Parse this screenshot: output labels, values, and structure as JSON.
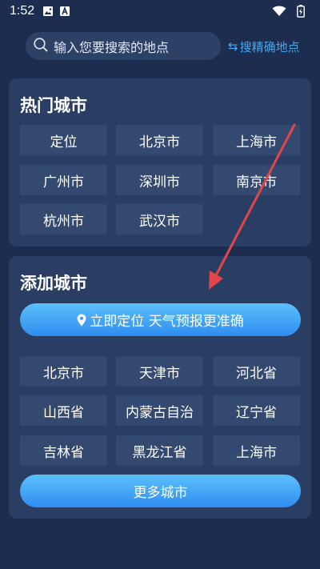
{
  "status_bar": {
    "time": "1:52",
    "icons": [
      "image-icon",
      "a-box-icon",
      "wifi-icon",
      "battery-charging-icon"
    ]
  },
  "search": {
    "placeholder": "输入您要搜索的地点",
    "icon": "search-icon"
  },
  "precise_link": {
    "label": "搜精确地点",
    "icon": "swap-arrows-icon"
  },
  "hot_cities": {
    "title": "热门城市",
    "items": [
      "定位",
      "北京市",
      "上海市",
      "广州市",
      "深圳市",
      "南京市",
      "杭州市",
      "武汉市"
    ]
  },
  "add_city": {
    "title": "添加城市",
    "locate_label": "立即定位 天气预报更准确",
    "locate_icon": "location-pin-icon",
    "items": [
      "北京市",
      "天津市",
      "河北省",
      "山西省",
      "内蒙古自治",
      "辽宁省",
      "吉林省",
      "黑龙江省",
      "上海市"
    ],
    "more_label": "更多城市"
  },
  "colors": {
    "background": "#1c2d4f",
    "card": "#2a3d62",
    "button": "#34496f",
    "accent": "#4aa6ea",
    "arrow": "#e0464a"
  }
}
